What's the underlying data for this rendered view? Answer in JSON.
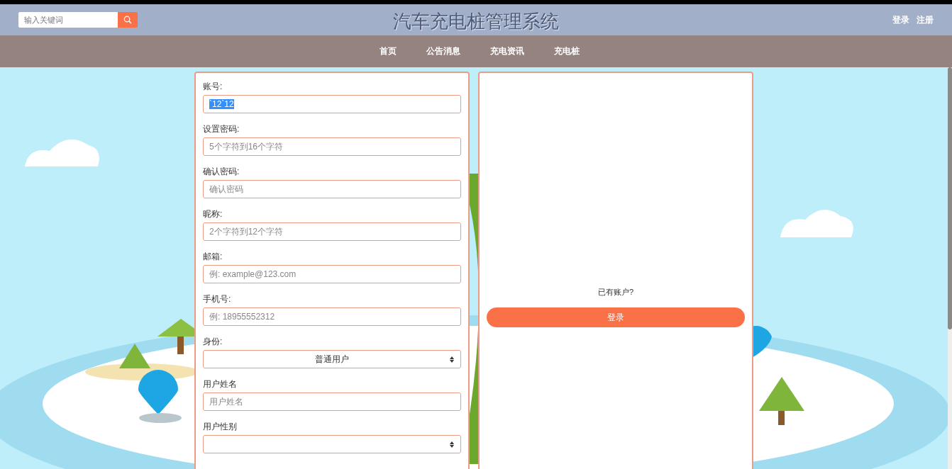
{
  "header": {
    "search": {
      "placeholder": "输入关键词"
    },
    "title": "汽车充电桩管理系统",
    "links": [
      "登录",
      "注册"
    ]
  },
  "nav": [
    "首页",
    "公告消息",
    "充电资讯",
    "充电桩"
  ],
  "form": {
    "fields": [
      {
        "kind": "text",
        "label": "账号:",
        "value": "`12`12",
        "text_selected": true
      },
      {
        "kind": "text",
        "label": "设置密码:",
        "placeholder": "5个字符到16个字符"
      },
      {
        "kind": "text",
        "label": "确认密码:",
        "placeholder": "确认密码"
      },
      {
        "kind": "text",
        "label": "昵称:",
        "placeholder": "2个字符到12个字符"
      },
      {
        "kind": "text",
        "label": "邮箱:",
        "placeholder": "例: example@123.com"
      },
      {
        "kind": "text",
        "label": "手机号:",
        "placeholder": "例: 18955552312"
      },
      {
        "kind": "select",
        "label": "身份:",
        "value": "普通用户"
      },
      {
        "kind": "text",
        "label": "用户姓名",
        "placeholder": "用户姓名"
      },
      {
        "kind": "select",
        "label": "用户性别"
      }
    ]
  },
  "login_panel": {
    "prompt": "已有账户?",
    "button": "登录"
  }
}
